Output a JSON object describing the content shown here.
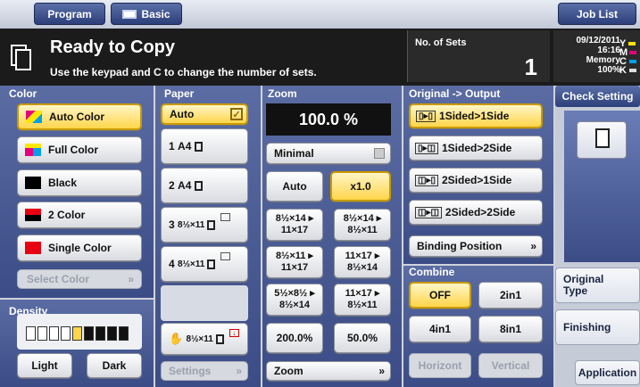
{
  "topbar": {
    "program": "Program",
    "basic": "Basic",
    "job_list": "Job List"
  },
  "header": {
    "status": "Ready to Copy",
    "instruction": "Use the keypad and C to change the number of sets.",
    "sets_label": "No. of Sets",
    "sets_value": "1",
    "date": "09/12/2011",
    "time": "16:16",
    "memory_label": "Memory",
    "memory_value": "100%",
    "toner": [
      "Y",
      "M",
      "C",
      "K"
    ]
  },
  "color": {
    "title": "Color",
    "items": [
      "Auto Color",
      "Full Color",
      "Black",
      "2 Color",
      "Single Color"
    ],
    "selected": "Auto Color",
    "select_color": "Select Color"
  },
  "density": {
    "title": "Density",
    "light": "Light",
    "dark": "Dark",
    "level_index": 4,
    "steps": 9
  },
  "paper": {
    "title": "Paper",
    "auto": "Auto",
    "trays": [
      {
        "num": "1",
        "size": "A4"
      },
      {
        "num": "2",
        "size": "A4"
      },
      {
        "num": "3",
        "size": "8½×11"
      },
      {
        "num": "4",
        "size": "8½×11"
      }
    ],
    "bypass_size": "8½×11",
    "settings": "Settings"
  },
  "zoom": {
    "title": "Zoom",
    "value": "100.0 %",
    "minimal": "Minimal",
    "auto": "Auto",
    "x1": "x1.0",
    "presets": [
      [
        "8½×14 ▸",
        "11×17"
      ],
      [
        "8½×14 ▸",
        "8½×11"
      ],
      [
        "8½×11 ▸",
        "11×17"
      ],
      [
        "11×17 ▸",
        "8½×14"
      ],
      [
        "5½×8½ ▸",
        "8½×14"
      ],
      [
        "11×17 ▸",
        "8½×11"
      ]
    ],
    "p200": "200.0%",
    "p50": "50.0%",
    "zoom_btn": "Zoom"
  },
  "original_output": {
    "title": "Original -> Output",
    "items": [
      "1Sided>1Side",
      "1Sided>2Side",
      "2Sided>1Side",
      "2Sided>2Side"
    ],
    "selected": "1Sided>1Side",
    "binding": "Binding Position"
  },
  "combine": {
    "title": "Combine",
    "items": [
      "OFF",
      "2in1",
      "4in1",
      "8in1"
    ],
    "selected": "OFF",
    "horizont": "Horizont",
    "vertical": "Vertical"
  },
  "right": {
    "check_setting": "Check Setting",
    "original_type": "Original Type",
    "finishing": "Finishing",
    "application": "Application"
  },
  "colors": {
    "accent": "#ffd54a",
    "header_bg": "#1b1b1b",
    "panel_blue": "#3b4c86"
  }
}
